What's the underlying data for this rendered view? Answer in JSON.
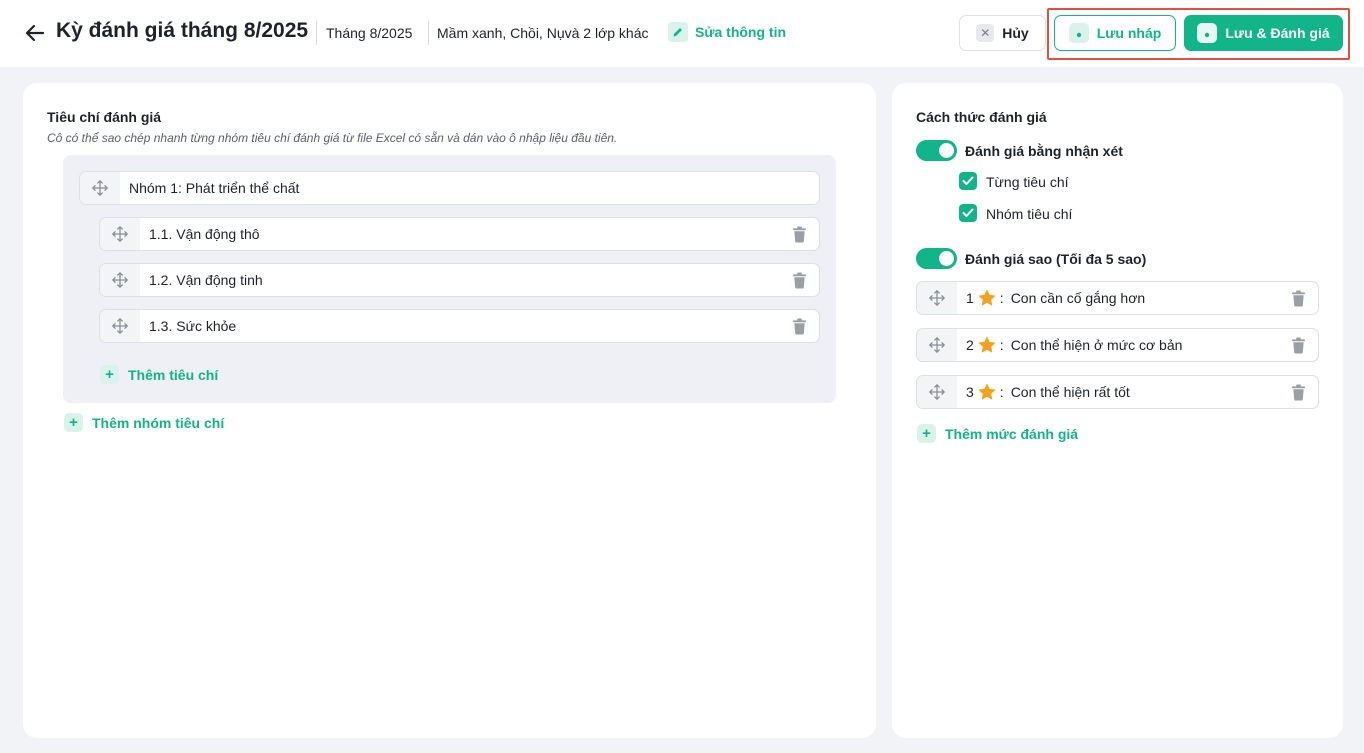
{
  "header": {
    "title": "Kỳ đánh giá tháng 8/2025",
    "period": "Tháng 8/2025",
    "classes": "Mầm xanh, Chồi, Nụvà 2 lớp khác",
    "edit_label": "Sửa thông tin",
    "cancel_label": "Hủy",
    "draft_label": "Lưu nháp",
    "save_label": "Lưu & Đánh giá"
  },
  "criteria": {
    "title": "Tiêu chí đánh giá",
    "subtitle": "Cô có thể sao chép nhanh từng nhóm tiêu chí đánh giá từ file Excel có sẵn và dán vào ô nhập liệu đầu tiên.",
    "group_name": "Nhóm 1: Phát triển thể chất",
    "items": [
      {
        "label": "1.1. Vận động thô"
      },
      {
        "label": "1.2. Vận động tinh"
      },
      {
        "label": "1.3. Sức khỏe"
      }
    ],
    "add_item_label": "Thêm tiêu chí",
    "add_group_label": "Thêm nhóm tiêu chí"
  },
  "method": {
    "title": "Cách thức đánh giá",
    "comment_toggle_label": "Đánh giá bằng nhận xét",
    "comment_toggle_on": true,
    "checks": [
      {
        "label": "Từng tiêu chí",
        "checked": true
      },
      {
        "label": "Nhóm tiêu chí",
        "checked": true
      }
    ],
    "star_toggle_label": "Đánh giá sao (Tối đa 5 sao)",
    "star_toggle_on": true,
    "levels": [
      {
        "num": "1",
        "label": "Con cần cố gắng hơn"
      },
      {
        "num": "2",
        "label": "Con thể hiện ở mức cơ bản"
      },
      {
        "num": "3",
        "label": "Con thể hiện rất tốt"
      }
    ],
    "add_level_label": "Thêm mức đánh giá"
  },
  "colors": {
    "accent": "#12b48a",
    "highlight": "#e0503f",
    "star": "#f6a21e"
  }
}
